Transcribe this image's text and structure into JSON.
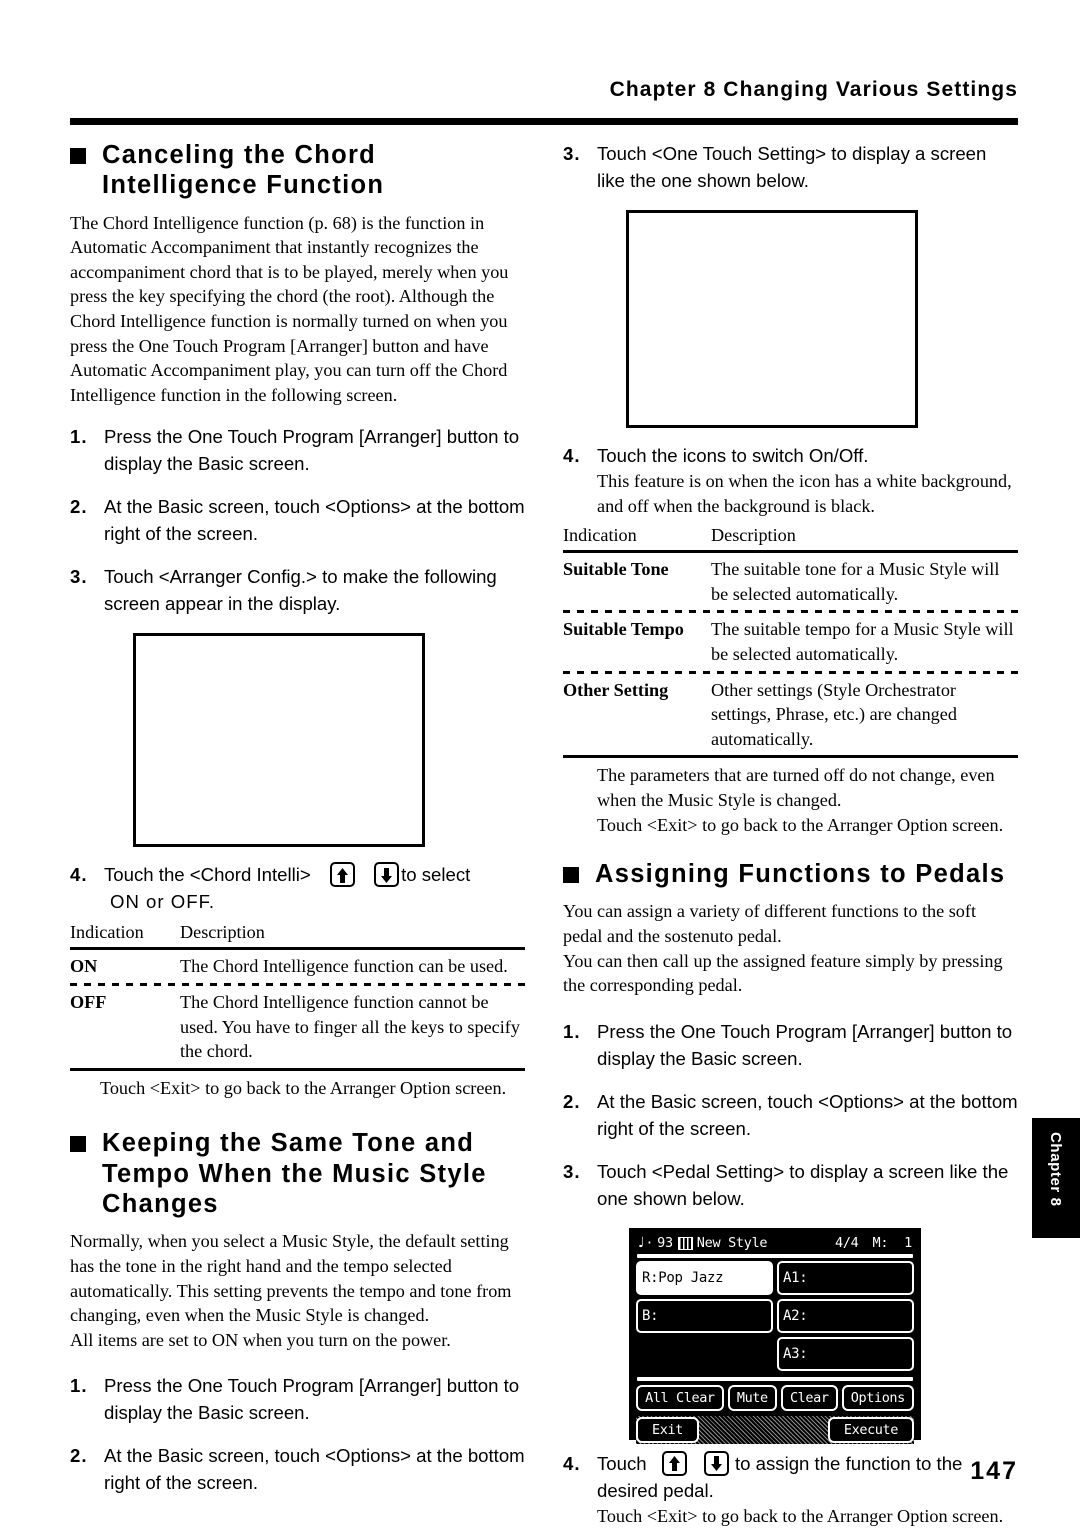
{
  "running_head": "Chapter 8 Changing Various Settings",
  "page_number": "147",
  "thumb_tab": "Chapter 8",
  "left_column": {
    "section1": {
      "heading_line1": "Canceling the Chord",
      "heading_line2": "Intelligence Function",
      "intro": "The Chord Intelligence function (p. 68) is the function in Automatic Accompaniment that instantly recognizes the accompaniment chord that is to be played, merely when you press the key specifying the chord (the root). Although the Chord Intelligence function is normally turned on when you press the One Touch Program [Arranger] button and have Automatic Accompaniment play, you can turn off the Chord Intelligence function in the following screen.",
      "steps": [
        {
          "num": "1.",
          "text": "Press the One Touch Program [Arranger] button to display the Basic screen."
        },
        {
          "num": "2.",
          "text": "At the Basic screen, touch <Options> at the bottom right of the screen."
        },
        {
          "num": "3.",
          "text": "Touch <Arranger Config.> to make the following screen appear in the display."
        }
      ],
      "step4": {
        "num": "4.",
        "text_before": "Touch the <Chord Intelli>",
        "text_after": "to select",
        "text_line2": "ON or OFF."
      },
      "table": {
        "header": {
          "indication": "Indication",
          "description": "Description"
        },
        "rows": [
          {
            "indication": "ON",
            "description": "The Chord Intelligence function can be used."
          },
          {
            "indication": "OFF",
            "description": "The Chord Intelligence function cannot be used. You have to finger all the keys to specify the chord."
          }
        ]
      },
      "note": "Touch <Exit> to go back to the Arranger Option screen."
    },
    "section2": {
      "heading_line1": "Keeping the Same Tone and",
      "heading_line2": "Tempo When the Music Style",
      "heading_line3": "Changes",
      "intro1": "Normally, when you select a Music Style, the default setting has the tone in the right hand and the tempo selected automatically. This setting prevents the tempo and tone from changing, even when the Music Style is changed.",
      "intro2": "All items are set to ON when you turn on the power.",
      "steps": [
        {
          "num": "1.",
          "text": "Press the One Touch Program [Arranger] button to display the Basic screen."
        },
        {
          "num": "2.",
          "text": "At the Basic screen, touch <Options> at the bottom right of the screen."
        }
      ]
    }
  },
  "right_column": {
    "section_cont": {
      "step3": {
        "num": "3.",
        "text": "Touch <One Touch Setting> to display a screen like the one shown below."
      },
      "step4": {
        "num": "4.",
        "text": "Touch the icons to switch On/Off.",
        "sub": "This feature is on when the icon has a white background, and off when the background is black."
      },
      "table": {
        "header": {
          "indication": "Indication",
          "description": "Description"
        },
        "rows": [
          {
            "indication": "Suitable Tone",
            "description": "The suitable tone for a Music Style will be selected automatically."
          },
          {
            "indication": "Suitable Tempo",
            "description": "The suitable tempo for a Music Style will be selected automatically."
          },
          {
            "indication": "Other Setting",
            "description": "Other settings (Style Orchestrator settings, Phrase, etc.) are changed automatically."
          }
        ]
      },
      "note1": "The parameters that are turned off do not change, even when the Music Style is changed.",
      "note2": "Touch <Exit> to go back to the Arranger Option screen."
    },
    "section3": {
      "heading": "Assigning Functions to Pedals",
      "intro1": "You can assign a variety of different functions to the soft pedal and the sostenuto pedal.",
      "intro2": "You can then call up the assigned feature simply by pressing the corresponding pedal.",
      "steps": [
        {
          "num": "1.",
          "text": "Press the One Touch Program [Arranger] button to display the Basic screen."
        },
        {
          "num": "2.",
          "text": "At the Basic screen, touch <Options> at the bottom right of the screen."
        },
        {
          "num": "3.",
          "text": "Touch <Pedal Setting> to display a screen like the one shown below."
        }
      ],
      "step4": {
        "num": "4.",
        "text_before": "Touch",
        "text_after": "to assign the function to the",
        "text_line2": "desired pedal.",
        "sub": "Touch <Exit> to go back to the Arranger Option screen."
      }
    },
    "lcd": {
      "title": {
        "tempo_note": "♩",
        "dot": "·",
        "bpm": "93",
        "style_name": "New Style",
        "time_signature": "4/4",
        "measure_label": "M:",
        "measure_value": "1"
      },
      "cells": [
        {
          "label": "R:Pop Jazz",
          "state": "on"
        },
        {
          "label": "A1:",
          "state": "off"
        },
        {
          "label": "B:",
          "state": "off"
        },
        {
          "label": "A2:",
          "state": "off"
        },
        {
          "label": "",
          "state": "blank"
        },
        {
          "label": "A3:",
          "state": "off"
        }
      ],
      "buttons": [
        "All Clear",
        "Mute",
        "Clear",
        "Options"
      ],
      "footer": {
        "left": "Exit",
        "right": "Execute"
      }
    }
  }
}
